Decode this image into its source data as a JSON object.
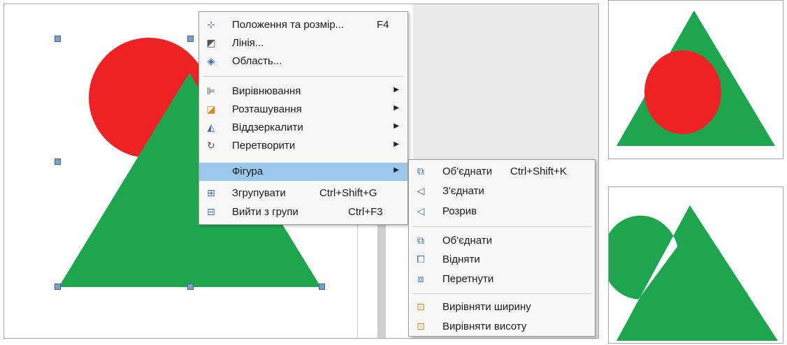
{
  "colors": {
    "triangle": "#1ea64f",
    "circle": "#ee2125",
    "menu_bg": "#f7f7f7",
    "highlight": "#99c8ec"
  },
  "context_menu": {
    "items": [
      {
        "icon": "position-size-icon",
        "label": "Положення та розмір...",
        "shortcut": "F4"
      },
      {
        "icon": "line-icon",
        "label": "Лінія..."
      },
      {
        "icon": "area-icon",
        "label": "Область..."
      },
      {
        "icon": "align-icon",
        "label": "Вирівнювання",
        "submenu": true
      },
      {
        "icon": "arrange-icon",
        "label": "Розташування",
        "submenu": true
      },
      {
        "icon": "flip-icon",
        "label": "Віддзеркалити",
        "submenu": true
      },
      {
        "icon": "convert-icon",
        "label": "Перетворити",
        "submenu": true
      },
      {
        "icon": "shape-icon",
        "label": "Фігура",
        "submenu": true,
        "highlighted": true
      },
      {
        "icon": "group-icon",
        "label": "Згрупувати",
        "shortcut": "Ctrl+Shift+G"
      },
      {
        "icon": "ungroup-icon",
        "label": "Вийти з групи",
        "shortcut": "Ctrl+F3"
      }
    ]
  },
  "shape_submenu": {
    "items": [
      {
        "icon": "merge-icon",
        "label": "Об'єднати",
        "shortcut": "Ctrl+Shift+K"
      },
      {
        "icon": "connect-icon",
        "label": "З'єднати"
      },
      {
        "icon": "break-icon",
        "label": "Розрив"
      },
      {
        "icon": "union-icon",
        "label": "Об'єднати"
      },
      {
        "icon": "subtract-icon",
        "label": "Відняти"
      },
      {
        "icon": "intersect-icon",
        "label": "Перетнути"
      },
      {
        "icon": "equal-width-icon",
        "label": "Вирівняти ширину"
      },
      {
        "icon": "equal-height-icon",
        "label": "Вирівняти висоту"
      }
    ]
  }
}
